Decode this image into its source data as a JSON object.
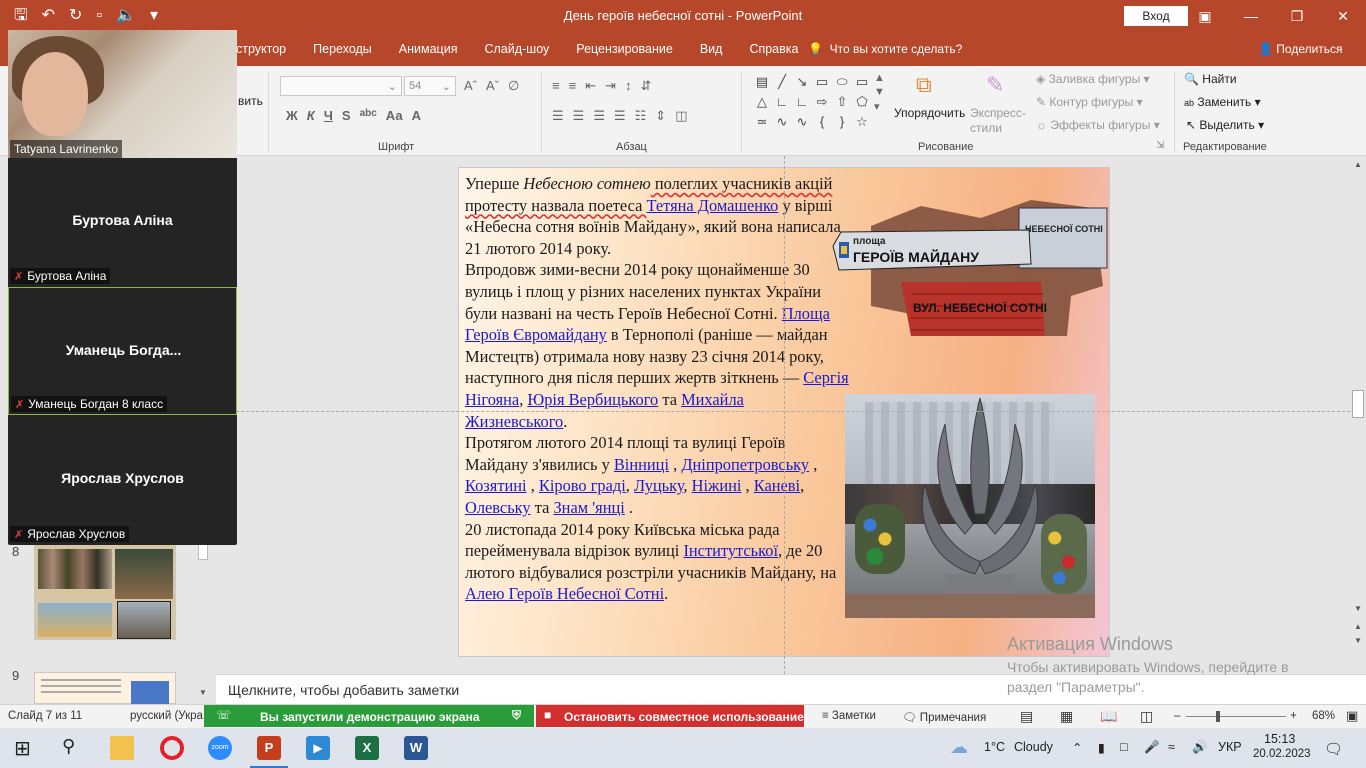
{
  "window": {
    "title": "День героїв небесної сотні - PowerPoint",
    "signin_label": "Вход"
  },
  "ribbon_tabs": [
    "Конструктор",
    "Переходы",
    "Анимация",
    "Слайд-шоу",
    "Рецензирование",
    "Вид",
    "Справка"
  ],
  "ribbon_tabs_visible": [
    "структор",
    "Переходы",
    "Анимация",
    "Слайд-шоу",
    "Рецензирование",
    "Вид",
    "Справка"
  ],
  "tell_me": "Что вы хотите сделать?",
  "share_label": "Поделиться",
  "ribbon": {
    "font_size_value": "54",
    "font_group_label": "Шрифт",
    "paragraph_group_label": "Абзац",
    "drawing_group_label": "Рисование",
    "editing_group_label": "Редактирование",
    "partial_left_label": "вить",
    "arrange_label": "Упорядочить",
    "quick_styles_label": "Экспресс-стили",
    "shape_fill": "Заливка фигуры",
    "shape_outline": "Контур фигуры",
    "shape_effects": "Эффекты фигуры",
    "find": "Найти",
    "replace": "Заменить",
    "select": "Выделить",
    "bold": "Ж",
    "italic": "К",
    "underline": "Ч",
    "strike": "S",
    "spacing": "abc",
    "case": "Аа",
    "font_color": "А"
  },
  "meeting": {
    "camera_name": "Tatyana Lavrinenko",
    "tiles": [
      {
        "title": "Буртова Аліна",
        "name": "Буртова Аліна",
        "active": false
      },
      {
        "title": "Уманець  Богда...",
        "name": "Уманець Богдан 8 класс",
        "active": true
      },
      {
        "title": "Ярослав Хруслов",
        "name": "Ярослав Хруслов",
        "active": false
      }
    ]
  },
  "slide_pane": {
    "slide_numbers": [
      "8",
      "9"
    ]
  },
  "slide": {
    "p1_a": "Уперше ",
    "p1_italic": "Небесною сотнею",
    "p1_b": " полеглих учасників акцій протесту назвала поетеса ",
    "p1_link": "Тетяна Домашенко",
    "p1_c": " у вірші «Небесна сотня воїнів Майдану», який вона написала 21 лютого 2014 року.",
    "p2_a": "Впродовж зими-весни 2014 року щонайменше 30 вулиць і площ у різних населених пунктах України були названі на честь Героїв Небесної Сотні. ",
    "p2_link1": "Площа Героїв Євромайдану",
    "p2_b": " в Тернополі (раніше — майдан Мистецтв) отримала нову назву 23 січня 2014 року, наступного дня після перших жертв зіткнень — ",
    "p2_link2": "Сергія Нігояна",
    "p2_c": ", ",
    "p2_link3": "Юрія Вербицького",
    "p2_d": " та ",
    "p2_link4": "Михайла Жизневського",
    "p2_e": ".",
    "p3_a": "Протягом лютого 2014 площі та вулиці Героїв Майдану з'явились у ",
    "p3_links": [
      "Вінниці",
      "Дніпропетровську",
      "Козятині",
      "Кірово граді",
      "Луцьку",
      "Ніжині",
      "Каневі",
      "Олевську",
      "Знам 'янці"
    ],
    "p4_a": "20 листопада 2014 року Київська міська рада перейменувала відрізок вулиці ",
    "p4_link1": "Інститутської",
    "p4_b": ", де 20 лютого відбувалися розстріли учасників Майдану, на ",
    "p4_link2": "Алею Героїв Небесної Сотні",
    "p4_c": ".",
    "sign_top": "площа",
    "sign_main": "ГЕРОЇВ МАЙДАНУ",
    "sign_side": "НЕБЕСНОЇ СОТНІ",
    "sign_street": "ВУЛ. НЕБЕСНОЇ СОТНІ"
  },
  "notes_placeholder": "Щелкните, чтобы добавить заметки",
  "watermark": {
    "title": "Активация Windows",
    "text": "Чтобы активировать Windows, перейдите в раздел \"Параметры\"."
  },
  "status": {
    "slide_of": "Слайд 7 из 11",
    "language": "русский (Укра",
    "sharing_message": "Вы запустили демонстрацию экрана",
    "stop_sharing": "Остановить совместное использование",
    "notes_btn": "Заметки",
    "comments_btn": "Примечания",
    "zoom_level": "68%",
    "zoom_fraction": 0.68
  },
  "taskbar": {
    "weather_temp": "1°C",
    "weather_text": "Cloudy",
    "keyboard_lang": "УКР",
    "time": "15:13",
    "date": "20.02.2023"
  },
  "colors": {
    "accent": "#b7472a",
    "share_green": "#2a9d3a",
    "share_red": "#d32f2f",
    "link": "#1a1ad4"
  }
}
